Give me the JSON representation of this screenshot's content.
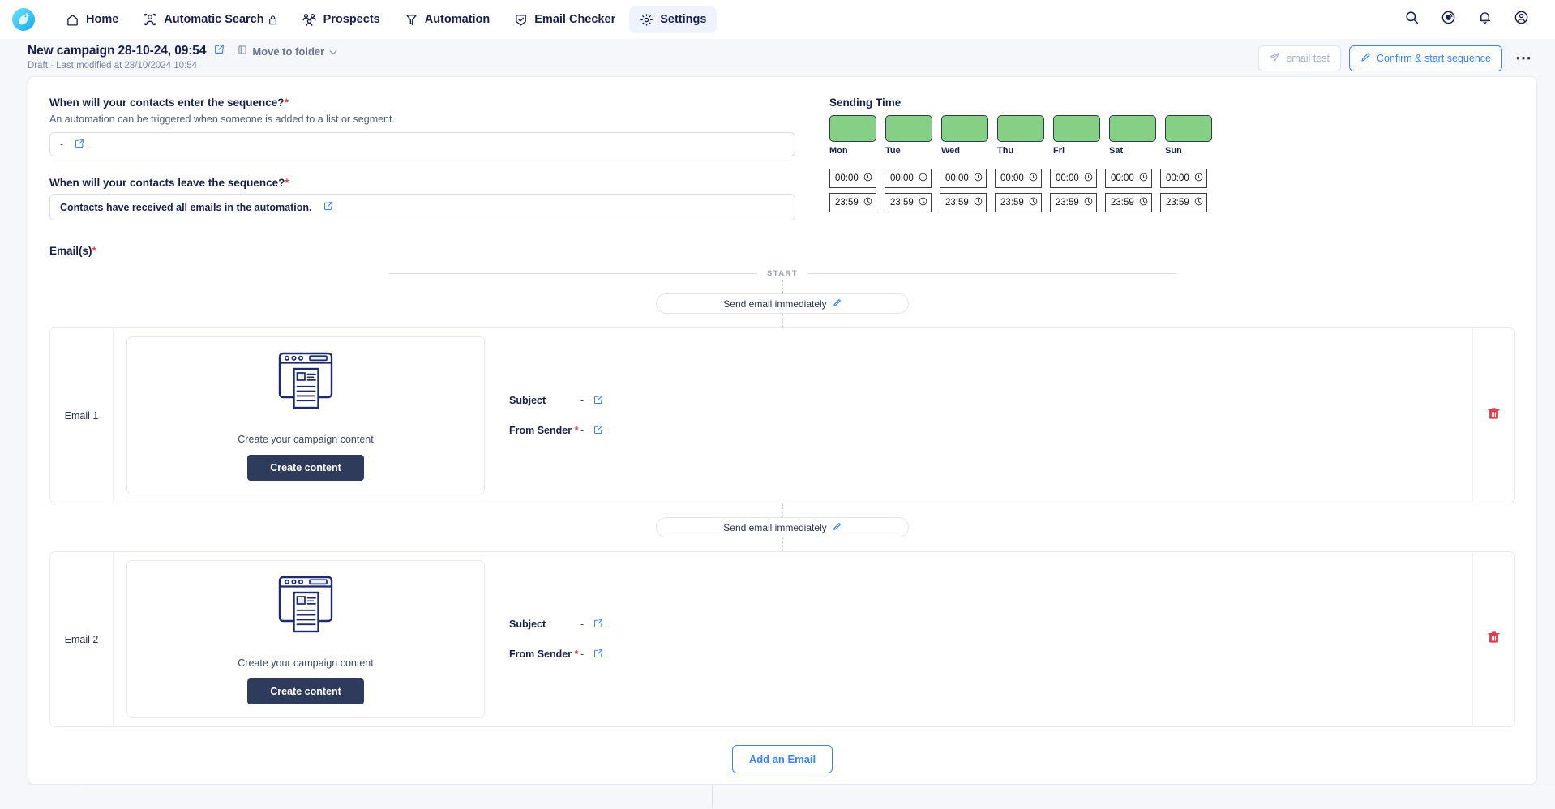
{
  "nav": {
    "logo_icon": "unicorn-logo",
    "items": [
      {
        "label": "Home",
        "icon": "home-icon",
        "active": false,
        "lock": false
      },
      {
        "label": "Automatic Search",
        "icon": "person-search-icon",
        "active": false,
        "lock": true
      },
      {
        "label": "Prospects",
        "icon": "people-icon",
        "active": false,
        "lock": false
      },
      {
        "label": "Automation",
        "icon": "funnel-icon",
        "active": false,
        "lock": false
      },
      {
        "label": "Email Checker",
        "icon": "shield-check-icon",
        "active": false,
        "lock": false
      },
      {
        "label": "Settings",
        "icon": "gear-icon",
        "active": true,
        "lock": false
      }
    ],
    "right_icons": [
      "search-icon",
      "help-circle-icon",
      "bell-icon",
      "account-icon"
    ]
  },
  "campaign": {
    "title": "New campaign 28-10-24, 09:54",
    "edit_icon": "edit-square-icon",
    "move_to_folder": "Move to folder",
    "move_icon": "folder-icon",
    "chevron_icon": "chevron-down-icon",
    "subtitle": "Draft - Last modified at 28/10/2024 10:54",
    "email_test_label": "email test",
    "email_test_icon": "paper-plane-icon",
    "confirm_label": "Confirm & start sequence",
    "confirm_icon": "pencil-icon",
    "more_icon": "more-dots-icon"
  },
  "enter": {
    "question": "When will your contacts enter the sequence?",
    "help": "An automation can be triggered when someone is added to a list or segment.",
    "value": "-",
    "edit_icon": "edit-square-icon"
  },
  "leave": {
    "question": "When will your contacts leave the sequence?",
    "value": "Contacts have received all emails in the automation.",
    "edit_icon": "edit-square-icon"
  },
  "sending_time": {
    "title": "Sending Time",
    "days": [
      {
        "name": "Mon",
        "enabled": true
      },
      {
        "name": "Tue",
        "enabled": true
      },
      {
        "name": "Wed",
        "enabled": true
      },
      {
        "name": "Thu",
        "enabled": true
      },
      {
        "name": "Fri",
        "enabled": true
      },
      {
        "name": "Sat",
        "enabled": true
      },
      {
        "name": "Sun",
        "enabled": true
      }
    ],
    "start_times": [
      "00:00",
      "00:00",
      "00:00",
      "00:00",
      "00:00",
      "00:00",
      "00:00"
    ],
    "end_times": [
      "23:59",
      "23:59",
      "23:59",
      "23:59",
      "23:59",
      "23:59",
      "23:59"
    ],
    "clock_icon": "clock-icon",
    "enabled_color": "#85d085"
  },
  "emails_section": {
    "title": "Email(s)",
    "start_label": "START",
    "delay_pill_1": "Send email immediately",
    "delay_pill_2": "Send email immediately",
    "pill_icon": "pencil-icon",
    "add_email_label": "Add an Email",
    "emails": [
      {
        "label": "Email 1",
        "illustration": "browser-document-illustration",
        "content_caption": "Create your campaign content",
        "create_button": "Create content",
        "subject_key": "Subject",
        "subject_value": "-",
        "sender_key": "From Sender",
        "sender_value": "-",
        "edit_icon": "edit-square-icon",
        "delete_icon": "trash-icon"
      },
      {
        "label": "Email 2",
        "illustration": "browser-document-illustration",
        "content_caption": "Create your campaign content",
        "create_button": "Create content",
        "subject_key": "Subject",
        "subject_value": "-",
        "sender_key": "From Sender",
        "sender_value": "-",
        "edit_icon": "edit-square-icon",
        "delete_icon": "trash-icon"
      }
    ]
  },
  "colors": {
    "accent_blue": "#3b82f6",
    "dark_navy": "#16204a",
    "required_red": "#e43b3b",
    "day_green": "#85d085",
    "button_dark": "#2f3b5c"
  }
}
